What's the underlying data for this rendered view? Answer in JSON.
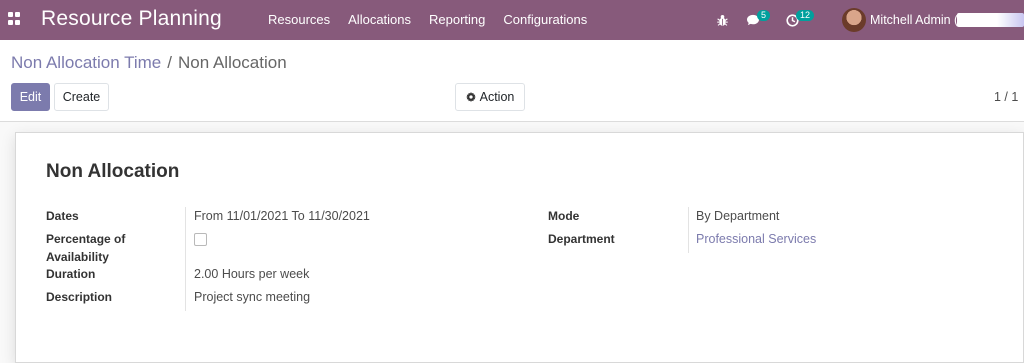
{
  "navbar": {
    "app_title": "Resource Planning",
    "menu": [
      "Resources",
      "Allocations",
      "Reporting",
      "Configurations"
    ],
    "chat_count": "5",
    "activity_count": "12",
    "user_name": "Mitchell Admin ("
  },
  "breadcrumb": {
    "parent": "Non Allocation Time",
    "separator": "/",
    "current": "Non Allocation"
  },
  "toolbar": {
    "edit_label": "Edit",
    "create_label": "Create",
    "action_label": "Action",
    "pager": "1 / 1"
  },
  "record": {
    "title": "Non Allocation",
    "dates_label": "Dates",
    "dates_from_prefix": "From",
    "dates_from": "11/01/2021",
    "dates_to_prefix": "To",
    "dates_to": "11/30/2021",
    "percentage_label_line1": "Percentage of",
    "percentage_label_line2": "Availability",
    "percentage_checked": false,
    "duration_label": "Duration",
    "duration_value": "2.00",
    "duration_unit": "Hours per week",
    "description_label": "Description",
    "description_value": "Project sync meeting",
    "mode_label": "Mode",
    "mode_value": "By Department",
    "department_label": "Department",
    "department_value": "Professional Services"
  },
  "colors": {
    "navbar": "#875a7b",
    "accent": "#7c7bad",
    "badge": "#00a09d"
  }
}
